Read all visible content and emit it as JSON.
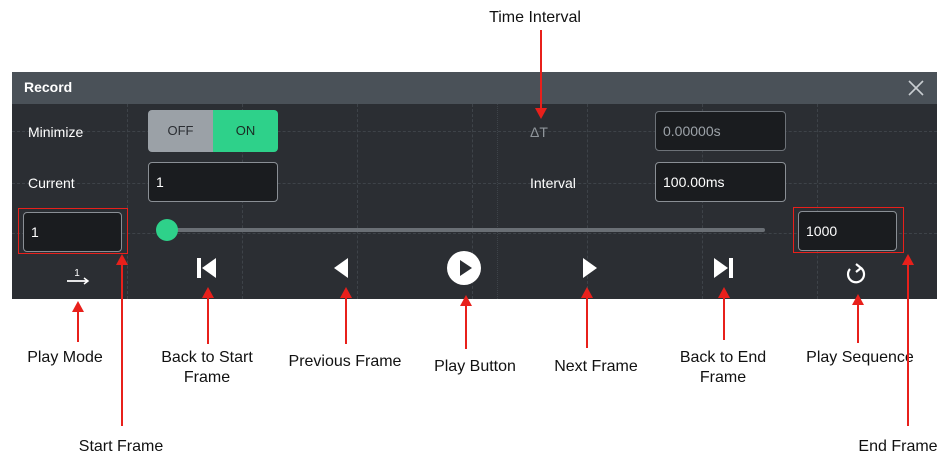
{
  "panel": {
    "title": "Record",
    "minimize_label": "Minimize",
    "toggle": {
      "off_label": "OFF",
      "on_label": "ON",
      "selected": "ON"
    },
    "current_label": "Current",
    "current_value": "1",
    "delta_t_label": "ΔT",
    "delta_t_value": "0.00000s",
    "interval_label": "Interval",
    "interval_value": "100.00ms",
    "start_frame_value": "1",
    "end_frame_value": "1000",
    "slider_position": 0,
    "colors": {
      "accent": "#2ed18a",
      "annotation": "#e8201b",
      "panel_bg": "#2b2e33",
      "titlebar_bg": "#4a5158"
    },
    "controls": {
      "play_mode_icon": "play-mode-icon",
      "back_to_start_icon": "skip-to-start-icon",
      "previous_icon": "previous-frame-icon",
      "play_icon": "play-circle-icon",
      "next_icon": "next-frame-icon",
      "back_to_end_icon": "skip-to-end-icon",
      "sequence_icon": "loop-icon",
      "play_mode_glyph": "1"
    }
  },
  "annotations": {
    "time_interval": "Time Interval",
    "play_mode": "Play Mode",
    "back_to_start": "Back to Start Frame",
    "previous_frame": "Previous Frame",
    "play_button": "Play Button",
    "next_frame": "Next Frame",
    "back_to_end": "Back to End Frame",
    "play_sequence": "Play Sequence",
    "start_frame": "Start Frame",
    "end_frame": "End Frame"
  }
}
